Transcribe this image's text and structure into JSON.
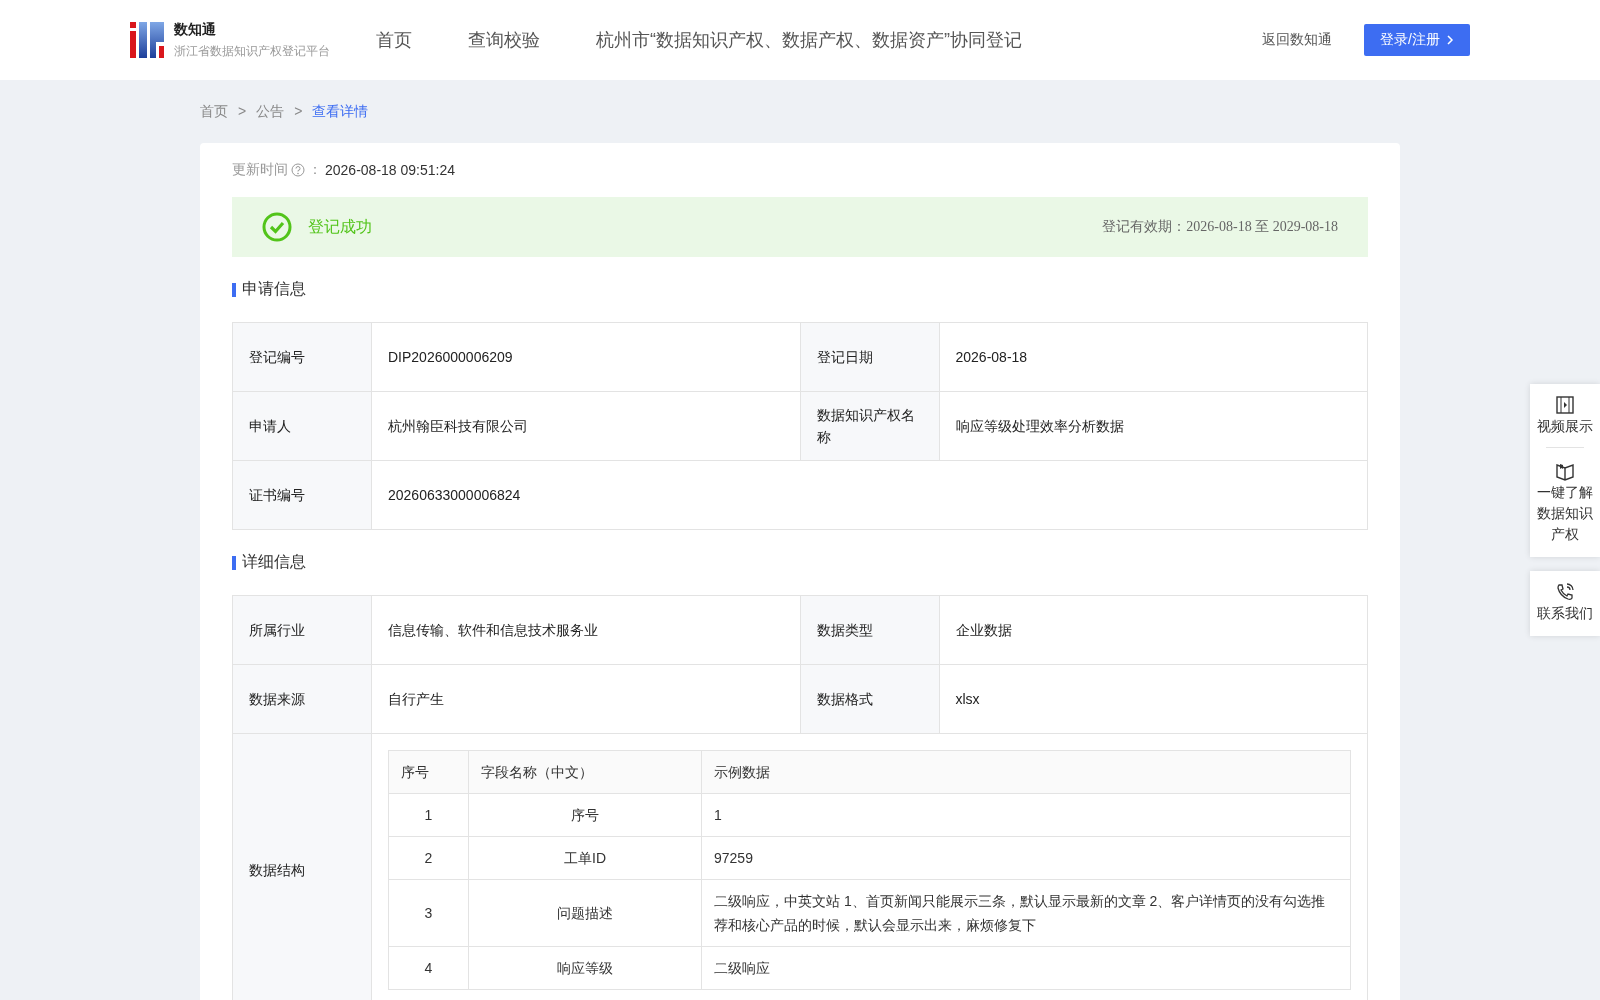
{
  "header": {
    "logo_title": "数知通",
    "logo_subtitle": "浙江省数据知识产权登记平台",
    "nav": [
      "首页",
      "查询校验",
      "杭州市“数据知识产权、数据产权、数据资产”协同登记"
    ],
    "back_link": "返回数知通",
    "login_button": "登录/注册"
  },
  "breadcrumb": [
    {
      "label": "首页",
      "selected": false
    },
    {
      "label": "公告",
      "selected": false
    },
    {
      "label": "查看详情",
      "selected": true
    }
  ],
  "breadcrumb_separator": ">",
  "update": {
    "label": "更新时间",
    "separator": "：",
    "value": "2026-08-18 09:51:24"
  },
  "status": {
    "text": "登记成功",
    "validity": "登记有效期：2026-08-18 至 2029-08-18"
  },
  "sections": [
    {
      "title": "申请信息",
      "rows": [
        [
          {
            "label": "登记编号",
            "value": "DIP2026000006209"
          },
          {
            "label": "登记日期",
            "value": "2026-08-18"
          }
        ],
        [
          {
            "label": "申请人",
            "value": "杭州翰臣科技有限公司"
          },
          {
            "label": "数据知识产权名称",
            "value": "响应等级处理效率分析数据"
          }
        ],
        [
          {
            "label": "证书编号",
            "value": "20260633000006824"
          }
        ]
      ]
    },
    {
      "title": "详细信息",
      "rows": [
        [
          {
            "label": "所属行业",
            "value": "信息传输、软件和信息技术服务业"
          },
          {
            "label": "数据类型",
            "value": "企业数据"
          }
        ],
        [
          {
            "label": "数据来源",
            "value": "自行产生"
          },
          {
            "label": "数据格式",
            "value": "xlsx"
          }
        ],
        [
          {
            "label": "数据结构",
            "table": {
              "columns": [
                "序号",
                "字段名称（中文）",
                "示例数据"
              ],
              "rows": [
                [
                  "1",
                  "序号",
                  "1"
                ],
                [
                  "2",
                  "工单ID",
                  "97259"
                ],
                [
                  "3",
                  "问题描述",
                  "二级响应，中英文站 1、首页新闻只能展示三条，默认显示最新的文章 2、客户详情页的没有勾选推荐和核心产品的时候，默认会显示出来，麻烦修复下"
                ],
                [
                  "4",
                  "响应等级",
                  "二级响应"
                ]
              ]
            }
          }
        ]
      ]
    }
  ],
  "side_panel": [
    {
      "kind": "video",
      "label": "视频展示"
    },
    {
      "kind": "book",
      "label": "一键了解数据知识产权"
    },
    {
      "kind": "phone",
      "label": "联系我们"
    }
  ]
}
